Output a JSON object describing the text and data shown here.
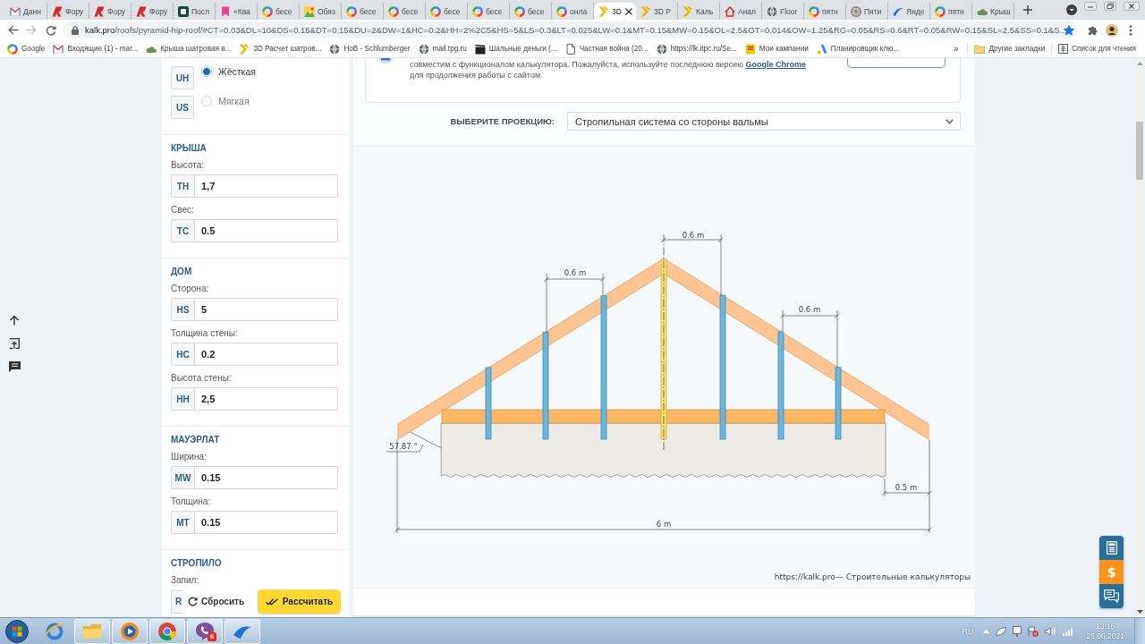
{
  "browser": {
    "tabs": [
      {
        "title": "Данн",
        "kind": "envelope",
        "selected": false
      },
      {
        "title": "Фору",
        "kind": "mark",
        "selected": false
      },
      {
        "title": "Фору",
        "kind": "mark",
        "selected": false
      },
      {
        "title": "Фору",
        "kind": "mark",
        "selected": false
      },
      {
        "title": "Посл",
        "kind": "tile",
        "selected": false
      },
      {
        "title": "«Ква",
        "kind": "bookmark",
        "selected": false
      },
      {
        "title": "бесе",
        "kind": "ring",
        "selected": false
      },
      {
        "title": "Обяз",
        "kind": "picture",
        "selected": false
      },
      {
        "title": "бесе",
        "kind": "ring",
        "selected": false
      },
      {
        "title": "бесе",
        "kind": "ring",
        "selected": false
      },
      {
        "title": "бесе",
        "kind": "ring",
        "selected": false
      },
      {
        "title": "бесе",
        "kind": "ring",
        "selected": false
      },
      {
        "title": "бесе",
        "kind": "ring",
        "selected": false
      },
      {
        "title": "онла",
        "kind": "ring",
        "selected": false
      },
      {
        "title": "3D",
        "kind": "chevron",
        "selected": true
      },
      {
        "title": "3D Р",
        "kind": "chevron",
        "selected": false
      },
      {
        "title": "Каль",
        "kind": "chevron",
        "selected": false
      },
      {
        "title": "Анал",
        "kind": "house",
        "selected": false
      },
      {
        "title": "Floor",
        "kind": "globe",
        "selected": false
      },
      {
        "title": "пятн",
        "kind": "ring",
        "selected": false
      },
      {
        "title": "Пяти",
        "kind": "wheel",
        "selected": false
      },
      {
        "title": "Янде",
        "kind": "wave",
        "selected": false
      },
      {
        "title": "пятн",
        "kind": "ring",
        "selected": false
      },
      {
        "title": "Крыш",
        "kind": "cloud",
        "selected": false
      }
    ],
    "address": {
      "host": "kalk.pro",
      "path": "/roofs/pyramid-hip-roof/#CT=0.03&DL=10&DS=0.15&DT=0.15&DU=2&DW=1&HC=0.2&HH=2%2C5&HS=5&LS=0.3&LT=0.025&LW=0.1&MT=0.15&MW=0.15&OL=2.5&OT=0.014&OW=1.25&RG=0.05&RS=0.6&RT=0.05&RW=0.15&SL=2.5&SS=0.1&S...",
      "bookmarked": true
    },
    "bookmarks": [
      {
        "title": "Google",
        "kind": "ring"
      },
      {
        "title": "Входящие (1) - mar...",
        "kind": "envelope"
      },
      {
        "title": "Крыша шатровая в...",
        "kind": "cloud"
      },
      {
        "title": "3D Расчет шатров...",
        "kind": "chevron"
      },
      {
        "title": "HoB - Schlumberger",
        "kind": "globe"
      },
      {
        "title": "mail.tpg.ru",
        "kind": "globe"
      },
      {
        "title": "Шальные деньги (...",
        "kind": "film"
      },
      {
        "title": "Частная война (20...",
        "kind": "page"
      },
      {
        "title": "https://lk.itpc.ru/Se...",
        "kind": "globe"
      },
      {
        "title": "Мои кампании",
        "kind": "flag"
      },
      {
        "title": "Планировщик клю...",
        "kind": "peak"
      }
    ],
    "bookmarks_more": "»",
    "other_bookmarks": "Другие закладки",
    "reading_list": "Список для чтения"
  },
  "sidebar": {
    "roof_type": [
      {
        "code": "UH",
        "label": "Жёсткая",
        "selected": true
      },
      {
        "code": "US",
        "label": "Мягкая",
        "selected": false
      }
    ],
    "sections": [
      {
        "title": "КРЫША",
        "fields": [
          {
            "label": "Высота:",
            "code": "TH",
            "value": "1,7"
          },
          {
            "label": "Свес:",
            "code": "TC",
            "value": "0.5"
          }
        ]
      },
      {
        "title": "ДОМ",
        "fields": [
          {
            "label": "Сторона:",
            "code": "HS",
            "value": "5"
          },
          {
            "label": "Толщина стены:",
            "code": "HC",
            "value": "0.2"
          },
          {
            "label": "Высота стены:",
            "code": "HH",
            "value": "2,5"
          }
        ]
      },
      {
        "title": "МАУЭРЛАТ",
        "fields": [
          {
            "label": "Ширина:",
            "code": "MW",
            "value": "0.15"
          },
          {
            "label": "Толщина:",
            "code": "MT",
            "value": "0.15"
          }
        ]
      },
      {
        "title": "СТРОПИЛО",
        "covered_field": {
          "label": "Запил:",
          "code": "R"
        }
      }
    ],
    "reset_button": "Сбросить",
    "calculate_button": "Рассчитать"
  },
  "notice": {
    "text_before": "совместим с функционалом калькулятора. Пожалуйста, используйте последнюю версию",
    "link": "Google Chrome",
    "text_after": "для продолжения работы с сайтом."
  },
  "projection": {
    "label": "ВЫБЕРИТЕ ПРОЕКЦИЮ:",
    "value": "Стропильная система со стороны вальмы"
  },
  "diagram": {
    "spacing_labels": [
      "0.6 m",
      "0.6 m",
      "0.6 m"
    ],
    "overhang_label": "0.5 m",
    "width_label": "6 m",
    "angle_label": "57.87 °"
  },
  "credit": "https://kalk.pro— Строительные калькуляторы",
  "support_widget": {
    "price_symbol": "$"
  },
  "taskbar": {
    "apps": [
      {
        "kind": "ring",
        "running": false
      },
      {
        "kind": "folder",
        "running": true
      },
      {
        "kind": "play",
        "running": true
      },
      {
        "kind": "pinwheel",
        "running": true
      },
      {
        "kind": "phone",
        "running": true,
        "badge": "6"
      },
      {
        "kind": "swoosh",
        "running": true
      }
    ],
    "language": "RU",
    "time": "13:16",
    "date": "25.06.2021"
  }
}
